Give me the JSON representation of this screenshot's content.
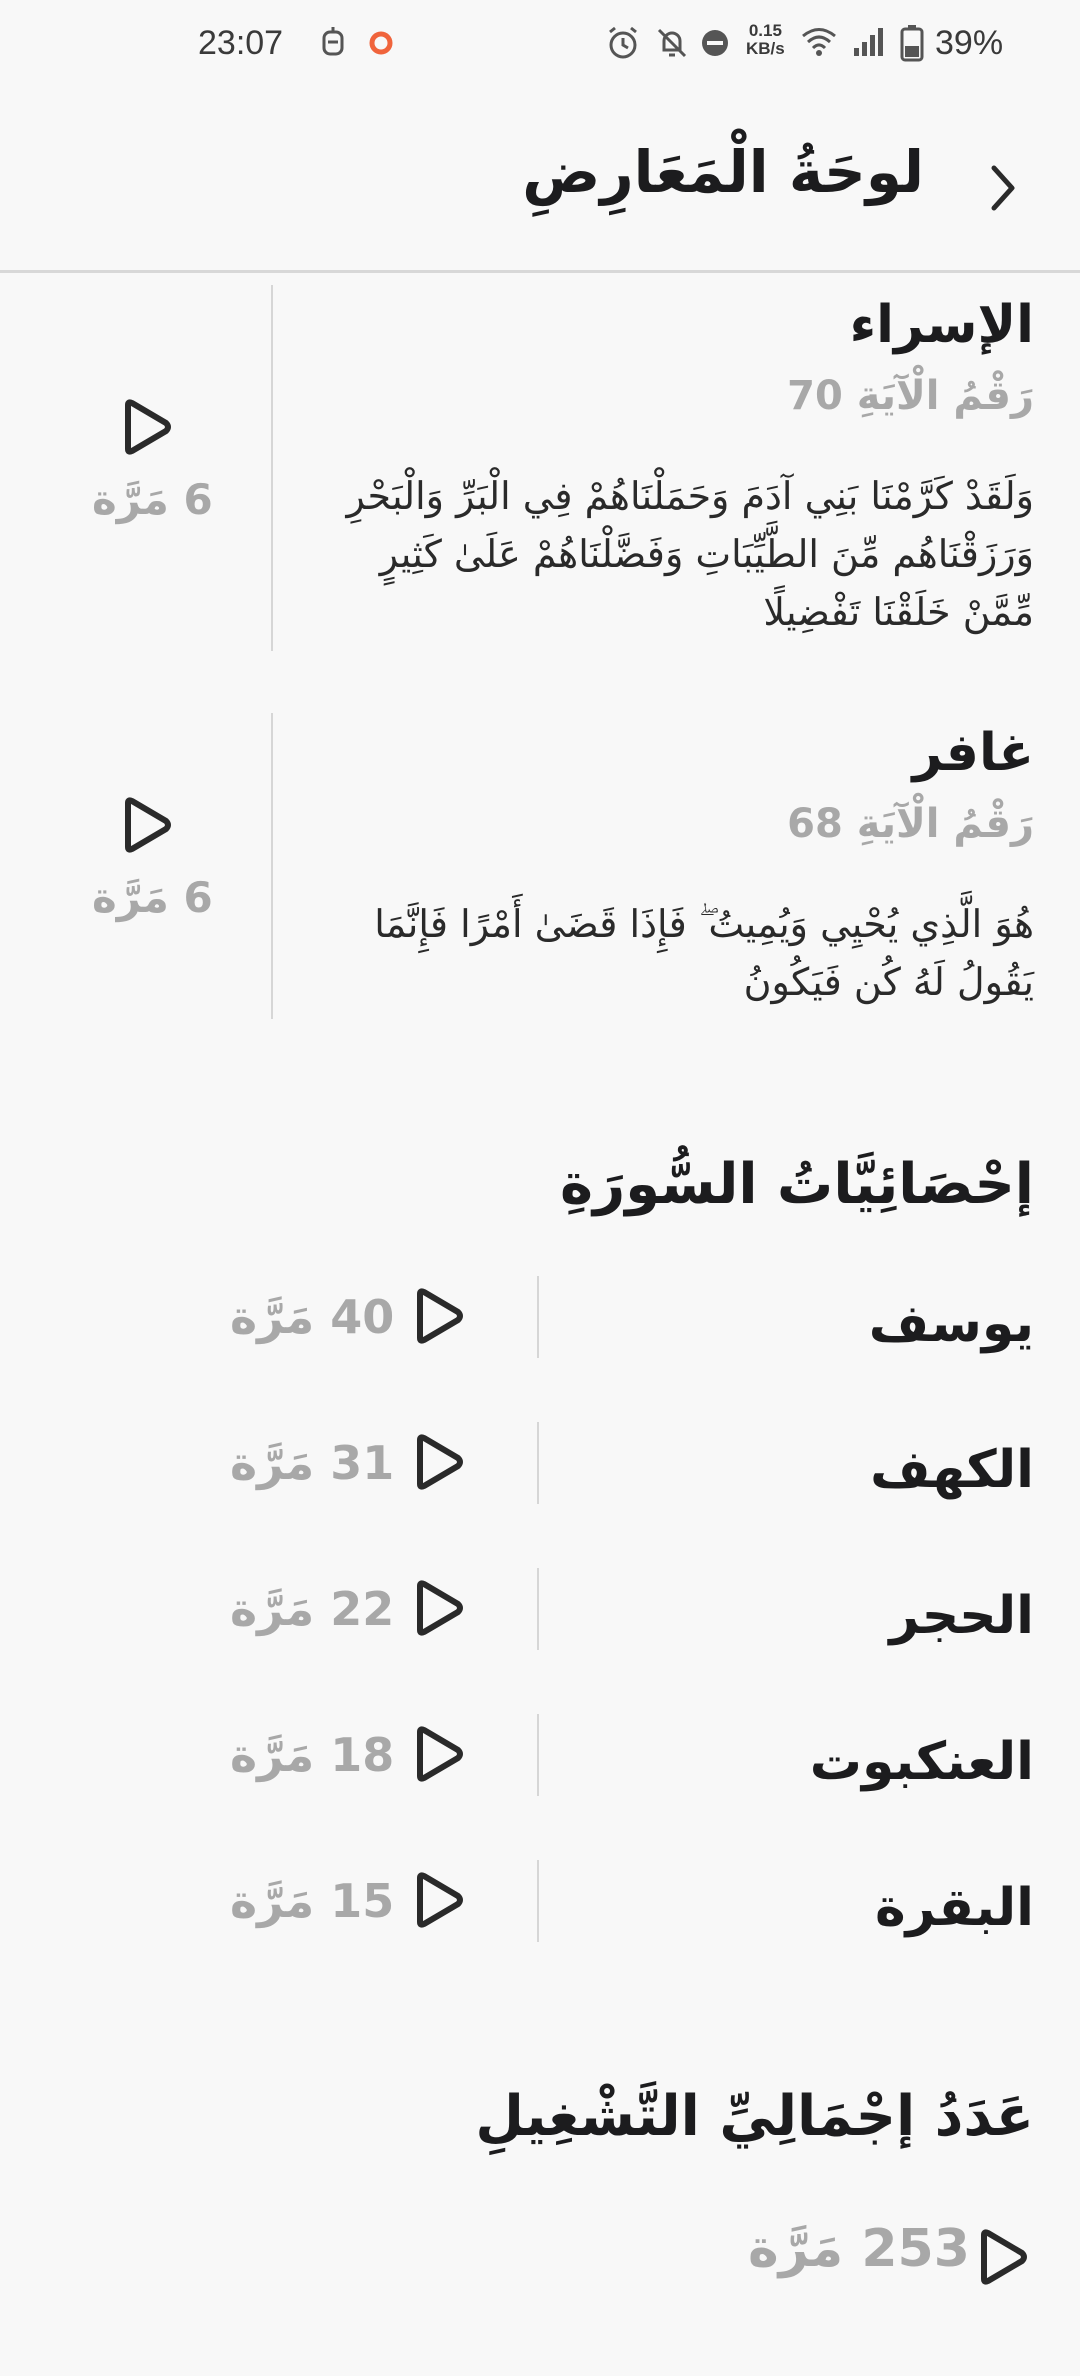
{
  "status_bar": {
    "time": "23:07",
    "speed_value": "0.15",
    "speed_unit": "KB/s",
    "battery": "39%",
    "icons": [
      "robot-icon",
      "recording-dot-icon",
      "alarm-icon",
      "mute-icon",
      "dnd-icon",
      "wifi-icon",
      "signal-icon",
      "battery-icon"
    ],
    "accent_dot_color": "#f0643c"
  },
  "header": {
    "title": "لوحَةُ الْمَعَارِضِ",
    "back_icon": "chevron-right-icon"
  },
  "featured": [
    {
      "surah": "الإسراء",
      "ayah_label": "رَقْمُ الْآيَةِ 70",
      "text": "وَلَقَدْ كَرَّمْنَا بَنِي آدَمَ وَحَمَلْنَاهُمْ فِي الْبَرِّ وَالْبَحْرِ وَرَزَقْنَاهُم مِّنَ الطَّيِّبَاتِ وَفَضَّلْنَاهُمْ عَلَىٰ كَثِيرٍ مِّمَّنْ خَلَقْنَا تَفْضِيلًا",
      "count": "6 مَرَّة"
    },
    {
      "surah": "غافر",
      "ayah_label": "رَقْمُ الْآيَةِ 68",
      "text": "هُوَ الَّذِي يُحْيِي وَيُمِيتُ ۖ فَإِذَا قَضَىٰ أَمْرًا فَإِنَّمَا يَقُولُ لَهُ كُن فَيَكُونُ",
      "count": "6 مَرَّة"
    }
  ],
  "stats": {
    "title": "إحْصَائِيَّاتُ السُّورَةِ",
    "rows": [
      {
        "name": "يوسف",
        "count": "40 مَرَّة"
      },
      {
        "name": "الكهف",
        "count": "31 مَرَّة"
      },
      {
        "name": "الحجر",
        "count": "22 مَرَّة"
      },
      {
        "name": "العنكبوت",
        "count": "18 مَرَّة"
      },
      {
        "name": "البقرة",
        "count": "15 مَرَّة"
      }
    ]
  },
  "total": {
    "title": "عَدَدُ إجْمَالِيِّ التَّشْغِيلِ",
    "count": "253 مَرَّة"
  },
  "colors": {
    "background": "#f8f8f8",
    "text": "#1c1c1e",
    "muted": "#a8a8a8",
    "divider": "#d6d6d6"
  }
}
